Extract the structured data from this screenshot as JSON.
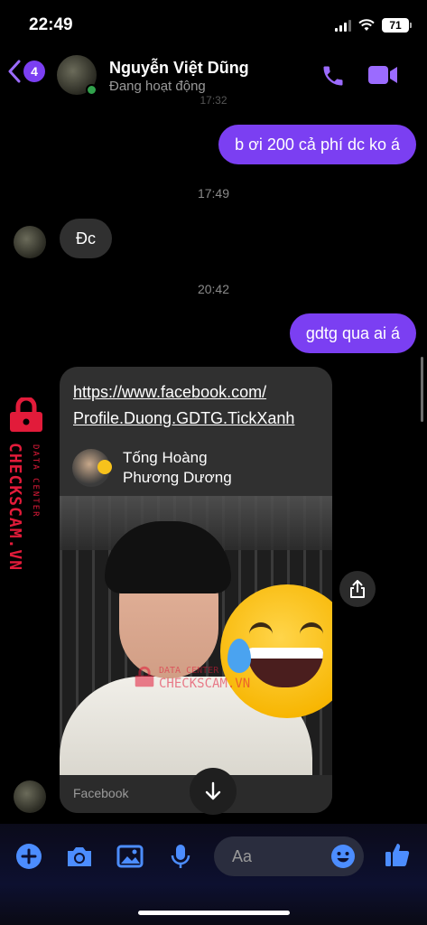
{
  "status_bar": {
    "time": "22:49",
    "battery": "71"
  },
  "header": {
    "back_badge": "4",
    "contact_name": "Nguyễn Việt Dũng",
    "contact_status": "Đang hoạt động",
    "top_partial_time": "17:32"
  },
  "messages": [
    {
      "type": "outgoing",
      "text": "b ơi 200 cả phí dc ko á"
    },
    {
      "type": "timestamp",
      "text": "17:49"
    },
    {
      "type": "incoming",
      "text": "Đc"
    },
    {
      "type": "timestamp",
      "text": "20:42"
    },
    {
      "type": "outgoing",
      "text": "gdtg qua ai á"
    }
  ],
  "link_card": {
    "url_line1": "https://www.facebook.com/",
    "url_line2": "Profile.Duong.GDTG.TickXanh",
    "profile_name_line1": "Tống Hoàng",
    "profile_name_line2": "Phương Dương",
    "source": "Facebook"
  },
  "watermark": {
    "side_text": "CHECKSCAM.VN",
    "side_subtext": "DATA CENTER",
    "center_text_small": "DATA CENTER",
    "center_text": "CHECKSCAM.VN"
  },
  "composer": {
    "placeholder": "Aa"
  },
  "colors": {
    "accent": "#7b3ff2",
    "incoming_bubble": "#303030",
    "online": "#31a24c",
    "composer_icons": "#4c8dff",
    "watermark": "#e21b3a"
  },
  "icons": [
    "back-chevron-icon",
    "phone-icon",
    "video-camera-icon",
    "share-icon",
    "arrow-down-icon",
    "plus-icon",
    "camera-icon",
    "image-icon",
    "microphone-icon",
    "emoji-icon",
    "thumbs-up-icon",
    "lock-icon"
  ]
}
